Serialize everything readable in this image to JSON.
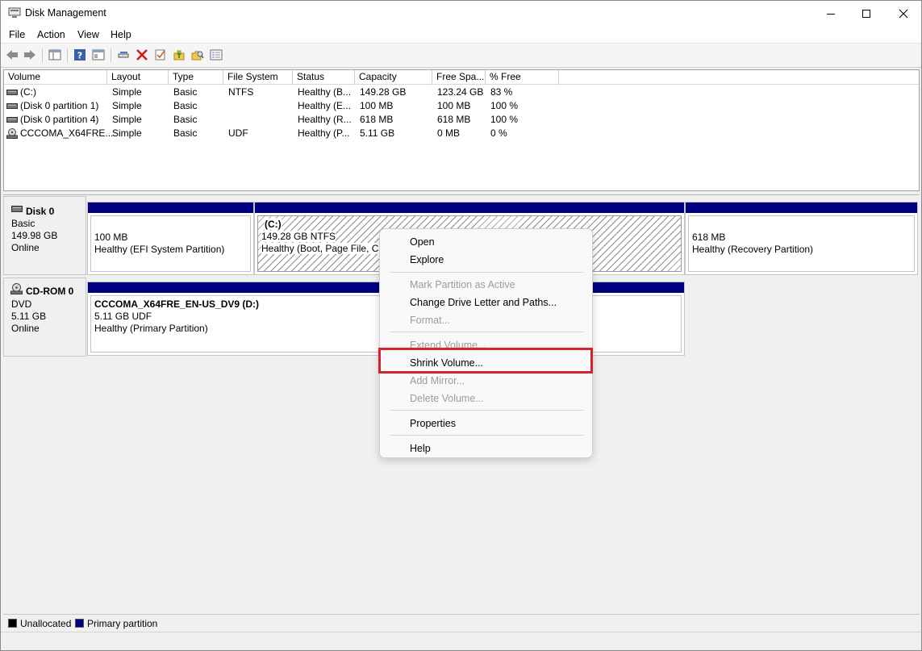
{
  "window": {
    "title": "Disk Management"
  },
  "menubar": {
    "file": "File",
    "action": "Action",
    "view": "View",
    "help": "Help"
  },
  "toolbar": {
    "icons": [
      "back-icon",
      "forward-icon",
      "show-hide-console-tree-icon",
      "help-icon",
      "properties-icon",
      "connect-icon",
      "delete-icon",
      "check-icon",
      "refresh-icon",
      "search-icon",
      "console-icon"
    ],
    "delete_color": "#d11a1a"
  },
  "volume_list": {
    "columns": [
      "Volume",
      "Layout",
      "Type",
      "File System",
      "Status",
      "Capacity",
      "Free Spa...",
      "% Free"
    ],
    "rows": [
      {
        "volume": "(C:)",
        "layout": "Simple",
        "type": "Basic",
        "fs": "NTFS",
        "status": "Healthy (B...",
        "capacity": "149.28 GB",
        "free": "123.24 GB",
        "pct": "83 %"
      },
      {
        "volume": "(Disk 0 partition 1)",
        "layout": "Simple",
        "type": "Basic",
        "fs": "",
        "status": "Healthy (E...",
        "capacity": "100 MB",
        "free": "100 MB",
        "pct": "100 %"
      },
      {
        "volume": "(Disk 0 partition 4)",
        "layout": "Simple",
        "type": "Basic",
        "fs": "",
        "status": "Healthy (R...",
        "capacity": "618 MB",
        "free": "618 MB",
        "pct": "100 %"
      },
      {
        "volume": "CCCOMA_X64FRE...",
        "layout": "Simple",
        "type": "Basic",
        "fs": "UDF",
        "status": "Healthy (P...",
        "capacity": "5.11 GB",
        "free": "0 MB",
        "pct": "0 %"
      }
    ]
  },
  "disks": [
    {
      "name": "Disk 0",
      "kind": "Basic",
      "size": "149.98 GB",
      "state": "Online",
      "partitions": [
        {
          "line1": "100 MB",
          "line2": "Healthy (EFI System Partition)"
        },
        {
          "title": "(C:)",
          "line1": "149.28 GB NTFS",
          "line2": "Healthy (Boot, Page File, Cra"
        },
        {
          "line1": "618 MB",
          "line2": "Healthy (Recovery Partition)"
        }
      ]
    },
    {
      "name": "CD-ROM 0",
      "kind": "DVD",
      "size": "5.11 GB",
      "state": "Online",
      "partitions": [
        {
          "title": "CCCOMA_X64FRE_EN-US_DV9  (D:)",
          "line1": "5.11 GB UDF",
          "line2": "Healthy (Primary Partition)"
        }
      ]
    }
  ],
  "legend": {
    "unallocated": "Unallocated",
    "primary": "Primary partition",
    "unallocated_color": "#000000",
    "primary_color": "#000080"
  },
  "context_menu": {
    "open": "Open",
    "explore": "Explore",
    "mark_active": "Mark Partition as Active",
    "change_letter": "Change Drive Letter and Paths...",
    "format": "Format...",
    "extend": "Extend Volume...",
    "shrink": "Shrink Volume...",
    "add_mirror": "Add Mirror...",
    "delete": "Delete Volume...",
    "properties": "Properties",
    "help": "Help"
  },
  "highlight_color": "#d32330"
}
